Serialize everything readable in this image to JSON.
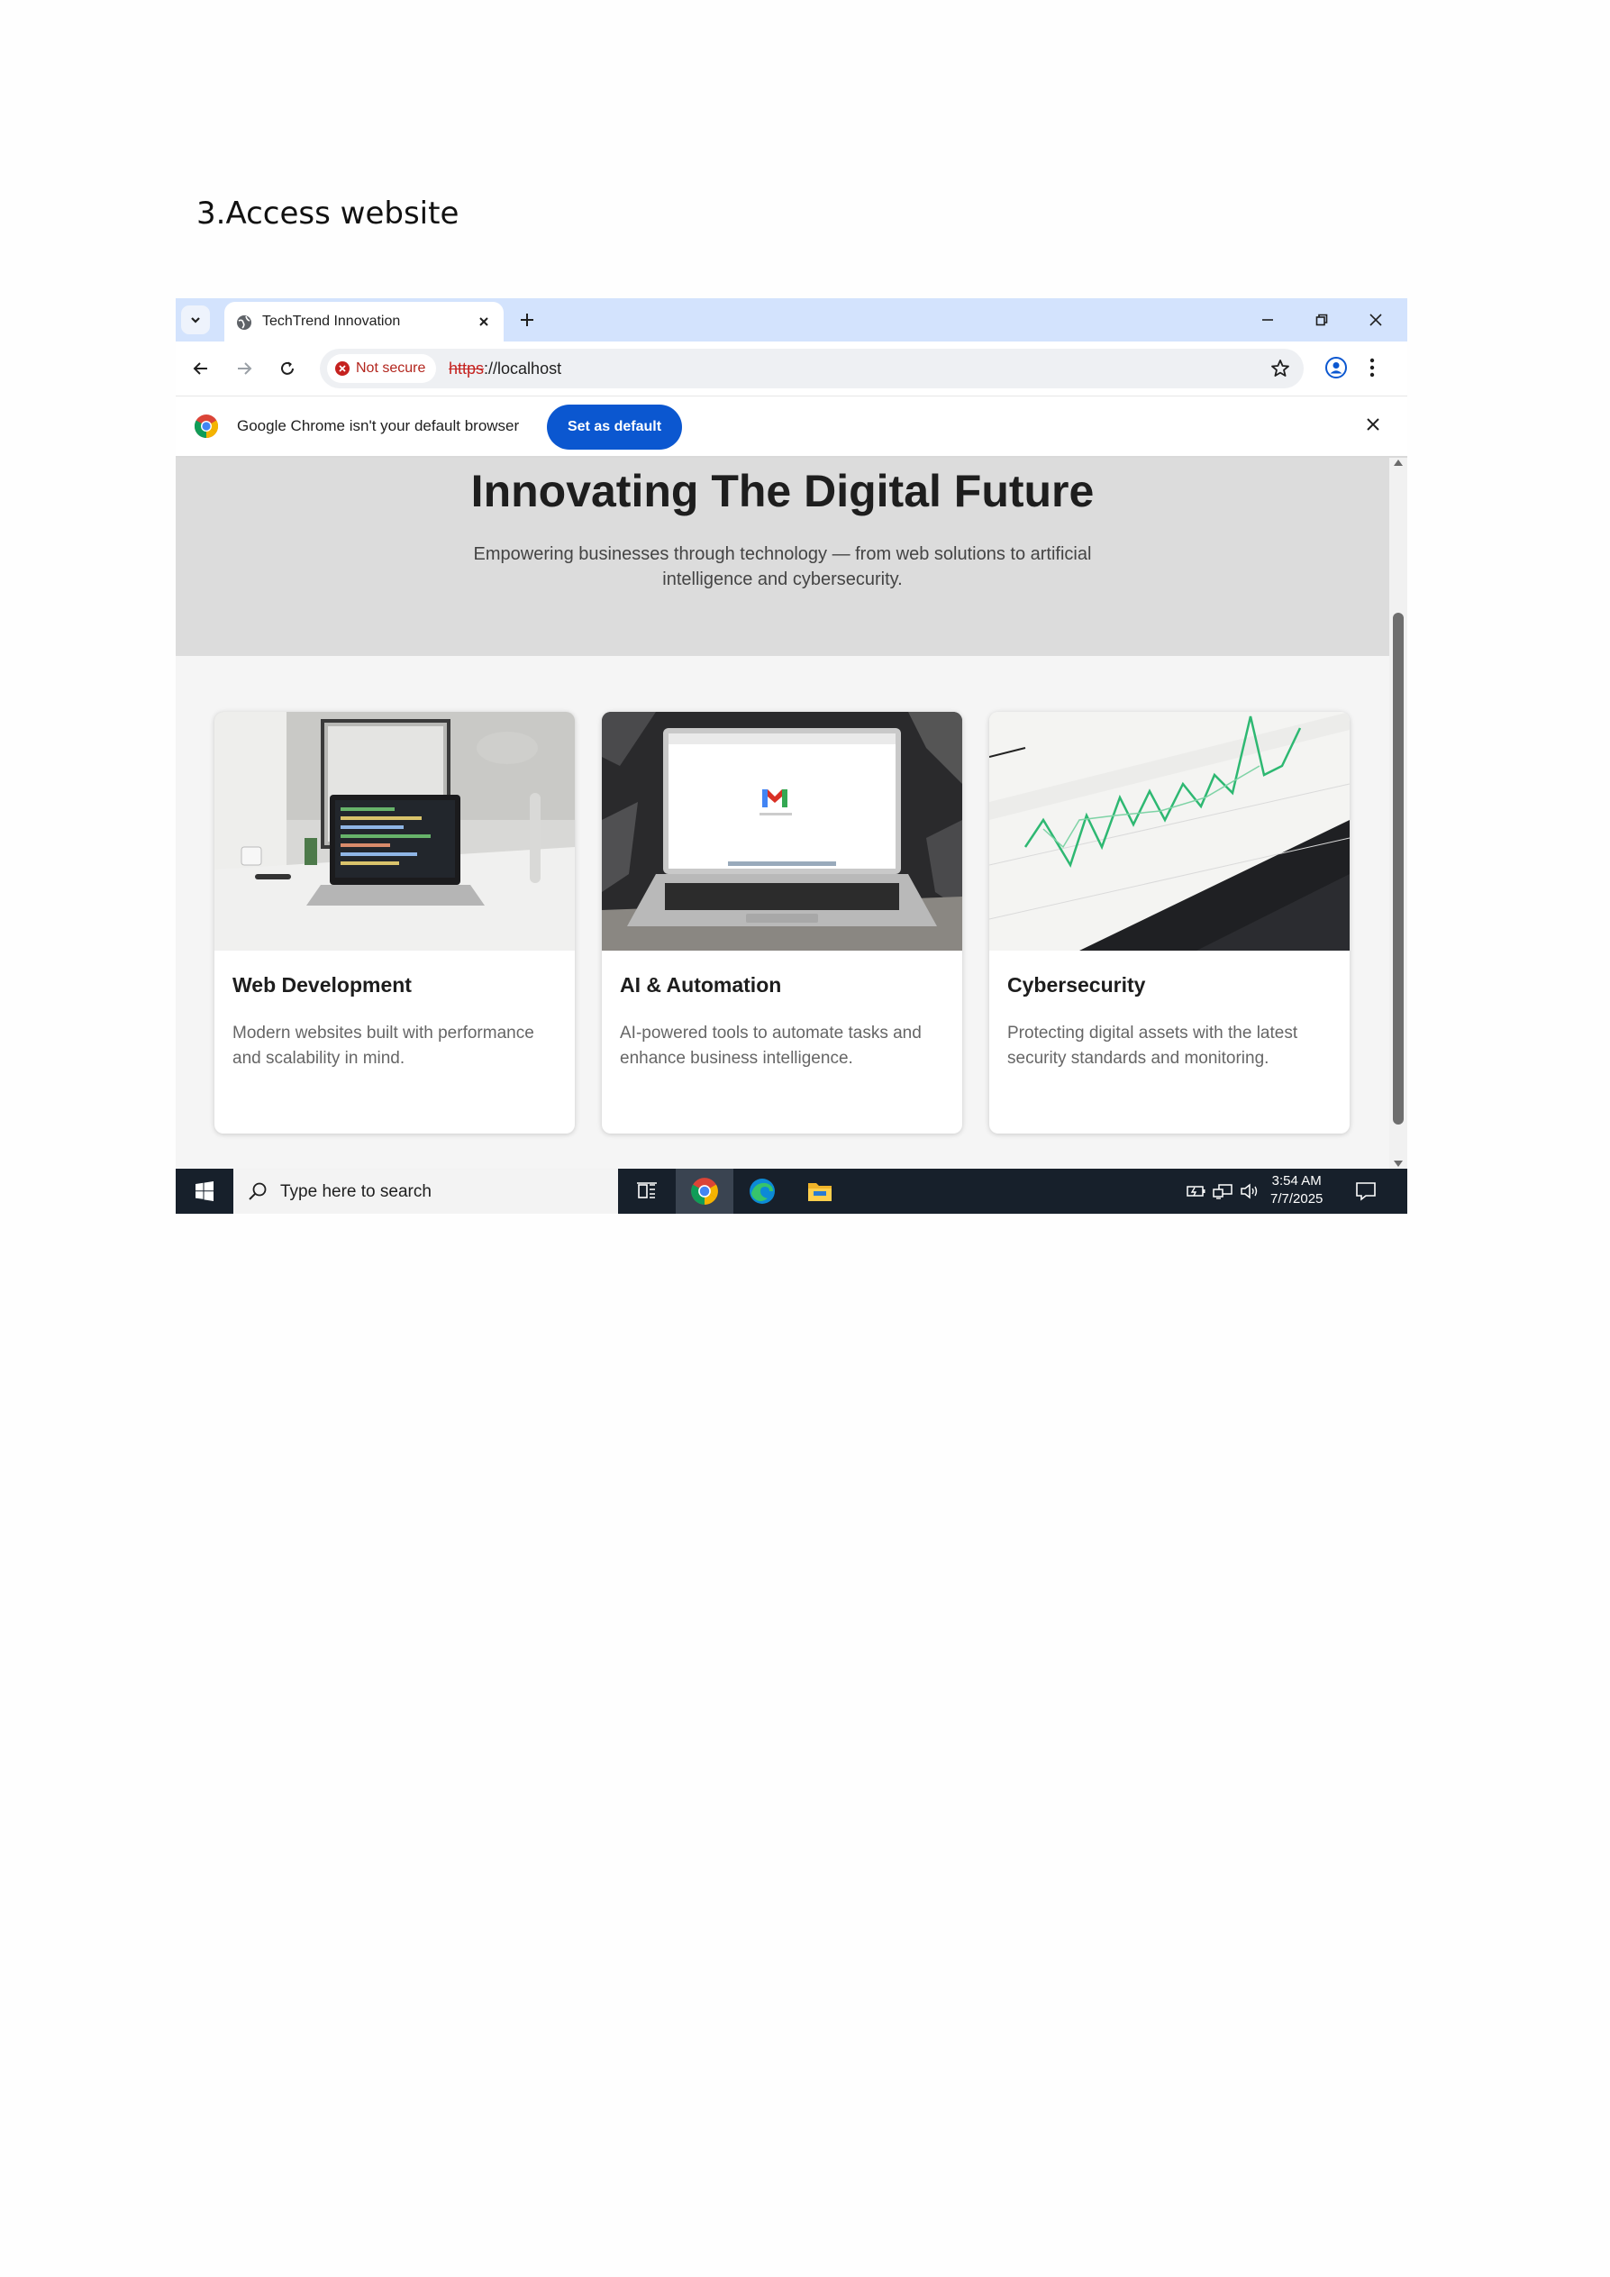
{
  "document": {
    "heading": "3.Access website"
  },
  "browser": {
    "tab": {
      "title": "TechTrend Innovation"
    },
    "address": {
      "security_label": "Not secure",
      "url_scheme": "https",
      "url_rest": "://localhost"
    },
    "infobar": {
      "message": "Google Chrome isn't your default browser",
      "button_label": "Set as default"
    }
  },
  "page": {
    "hero": {
      "title": "Innovating The Digital Future",
      "subtitle": "Empowering businesses through technology — from web solutions to artificial intelligence and cybersecurity."
    },
    "cards": [
      {
        "title": "Web Development",
        "text": "Modern websites built with performance and scalability in mind."
      },
      {
        "title": "AI & Automation",
        "text": "AI-powered tools to automate tasks and enhance business intelligence."
      },
      {
        "title": "Cybersecurity",
        "text": "Protecting digital assets with the latest security standards and monitoring."
      }
    ]
  },
  "taskbar": {
    "search_placeholder": "Type here to search",
    "time": "3:54 AM",
    "date": "7/7/2025"
  },
  "colors": {
    "accent": "#0b57d0",
    "tab_strip": "#d3e3fd",
    "taskbar": "#17202b",
    "hero_bg": "#dcdcdc"
  }
}
